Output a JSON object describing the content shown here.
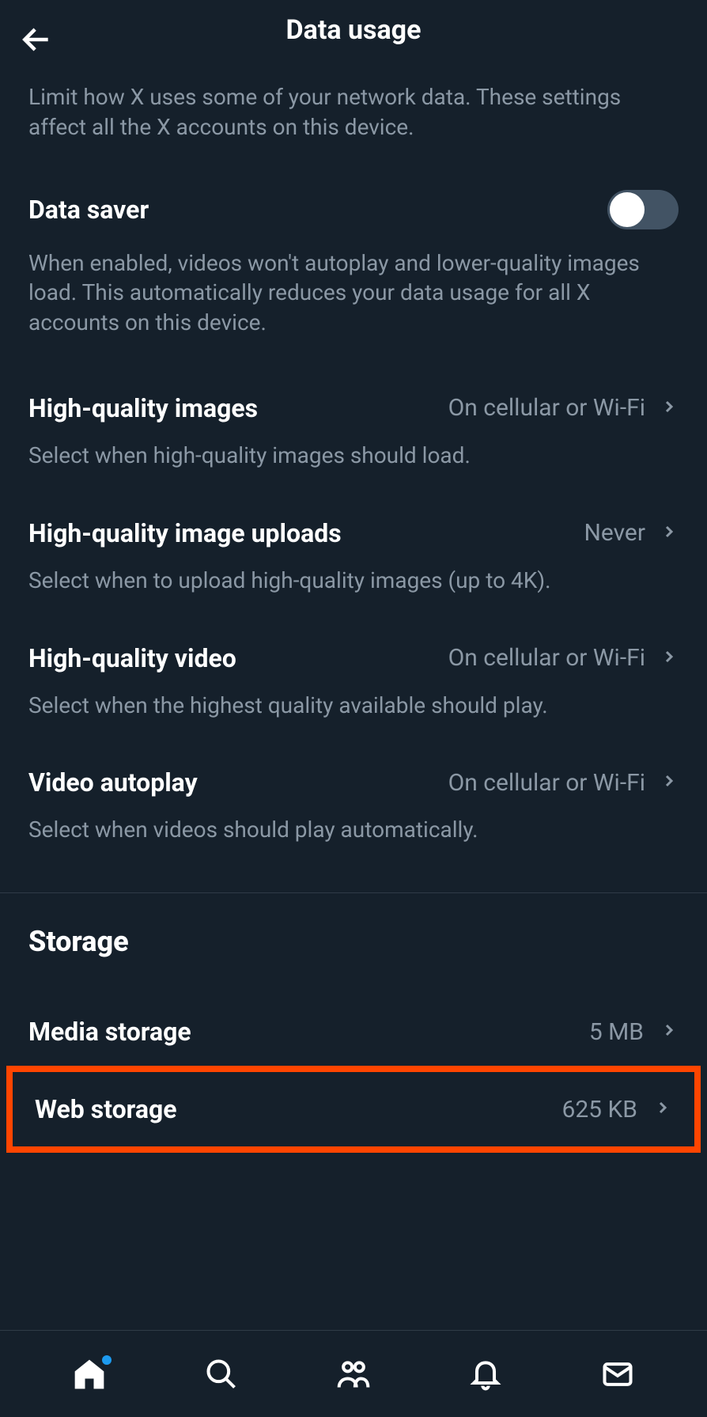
{
  "header": {
    "title": "Data usage"
  },
  "description": "Limit how X uses some of your network data. These settings affect all the X accounts on this device.",
  "dataSaver": {
    "label": "Data saver",
    "description": "When enabled, videos won't autoplay and lower-quality images load. This automatically reduces your data usage for all X accounts on this device."
  },
  "settings": {
    "hqImages": {
      "label": "High-quality images",
      "value": "On cellular or Wi-Fi",
      "description": "Select when high-quality images should load."
    },
    "hqUploads": {
      "label": "High-quality image uploads",
      "value": "Never",
      "description": "Select when to upload high-quality images (up to 4K)."
    },
    "hqVideo": {
      "label": "High-quality video",
      "value": "On cellular or Wi-Fi",
      "description": "Select when the highest quality available should play."
    },
    "videoAutoplay": {
      "label": "Video autoplay",
      "value": "On cellular or Wi-Fi",
      "description": "Select when videos should play automatically."
    }
  },
  "storage": {
    "title": "Storage",
    "media": {
      "label": "Media storage",
      "value": "5 MB"
    },
    "web": {
      "label": "Web storage",
      "value": "625 KB"
    }
  }
}
